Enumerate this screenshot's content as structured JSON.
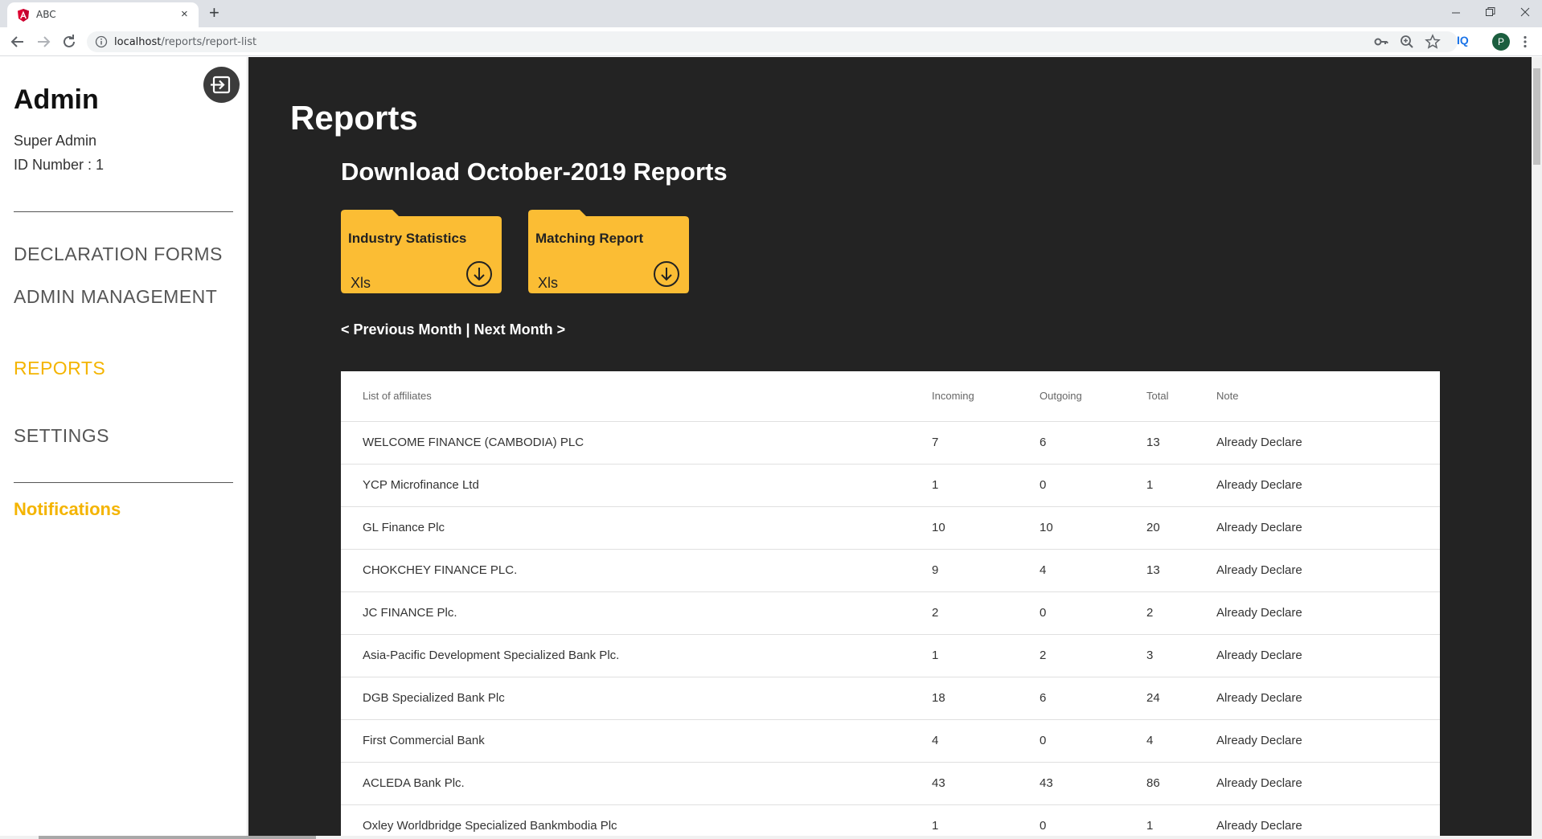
{
  "browser": {
    "tab_title": "ABC",
    "tab_close": "×",
    "new_tab": "+",
    "url_host": "localhost",
    "url_path": "/reports/report-list",
    "iq_label": "IQ",
    "profile_initial": "P"
  },
  "sidebar": {
    "title": "Admin",
    "role": "Super Admin",
    "id_line": "ID Number : 1",
    "nav": {
      "declaration": "DECLARATION FORMS",
      "admin_management": "ADMIN MANAGEMENT",
      "reports": "REPORTS",
      "settings": "SETTINGS"
    },
    "notifications": "Notifications"
  },
  "main": {
    "page_title": "Reports",
    "download_title": "Download October-2019 Reports",
    "cards": [
      {
        "title": "Industry Statistics",
        "type": "Xls"
      },
      {
        "title": "Matching Report",
        "type": "Xls"
      }
    ],
    "month_nav": {
      "previous": "< Previous Month",
      "separator": " | ",
      "next": "Next Month >"
    },
    "table": {
      "headers": {
        "name": "List of affiliates",
        "incoming": "Incoming",
        "outgoing": "Outgoing",
        "total": "Total",
        "note": "Note"
      },
      "rows": [
        {
          "name": "WELCOME FINANCE (CAMBODIA) PLC",
          "incoming": "7",
          "outgoing": "6",
          "total": "13",
          "note": "Already Declare"
        },
        {
          "name": "YCP Microfinance Ltd",
          "incoming": "1",
          "outgoing": "0",
          "total": "1",
          "note": "Already Declare"
        },
        {
          "name": "GL Finance Plc",
          "incoming": "10",
          "outgoing": "10",
          "total": "20",
          "note": "Already Declare"
        },
        {
          "name": "CHOKCHEY FINANCE PLC.",
          "incoming": "9",
          "outgoing": "4",
          "total": "13",
          "note": "Already Declare"
        },
        {
          "name": "JC FINANCE Plc.",
          "incoming": "2",
          "outgoing": "0",
          "total": "2",
          "note": "Already Declare"
        },
        {
          "name": "Asia-Pacific Development Specialized Bank Plc.",
          "incoming": "1",
          "outgoing": "2",
          "total": "3",
          "note": "Already Declare"
        },
        {
          "name": "DGB Specialized Bank Plc",
          "incoming": "18",
          "outgoing": "6",
          "total": "24",
          "note": "Already Declare"
        },
        {
          "name": "First Commercial Bank",
          "incoming": "4",
          "outgoing": "0",
          "total": "4",
          "note": "Already Declare"
        },
        {
          "name": "ACLEDA Bank Plc.",
          "incoming": "43",
          "outgoing": "43",
          "total": "86",
          "note": "Already Declare"
        },
        {
          "name": "Oxley Worldbridge Specialized Bankmbodia Plc",
          "incoming": "1",
          "outgoing": "0",
          "total": "1",
          "note": "Already Declare"
        }
      ]
    }
  },
  "colors": {
    "accent": "#f4b400",
    "card": "#fbbd34",
    "main_bg": "#232323"
  },
  "icons": {
    "logout": "logout-icon",
    "download": "download-circle-icon",
    "favicon": "angular-icon"
  }
}
